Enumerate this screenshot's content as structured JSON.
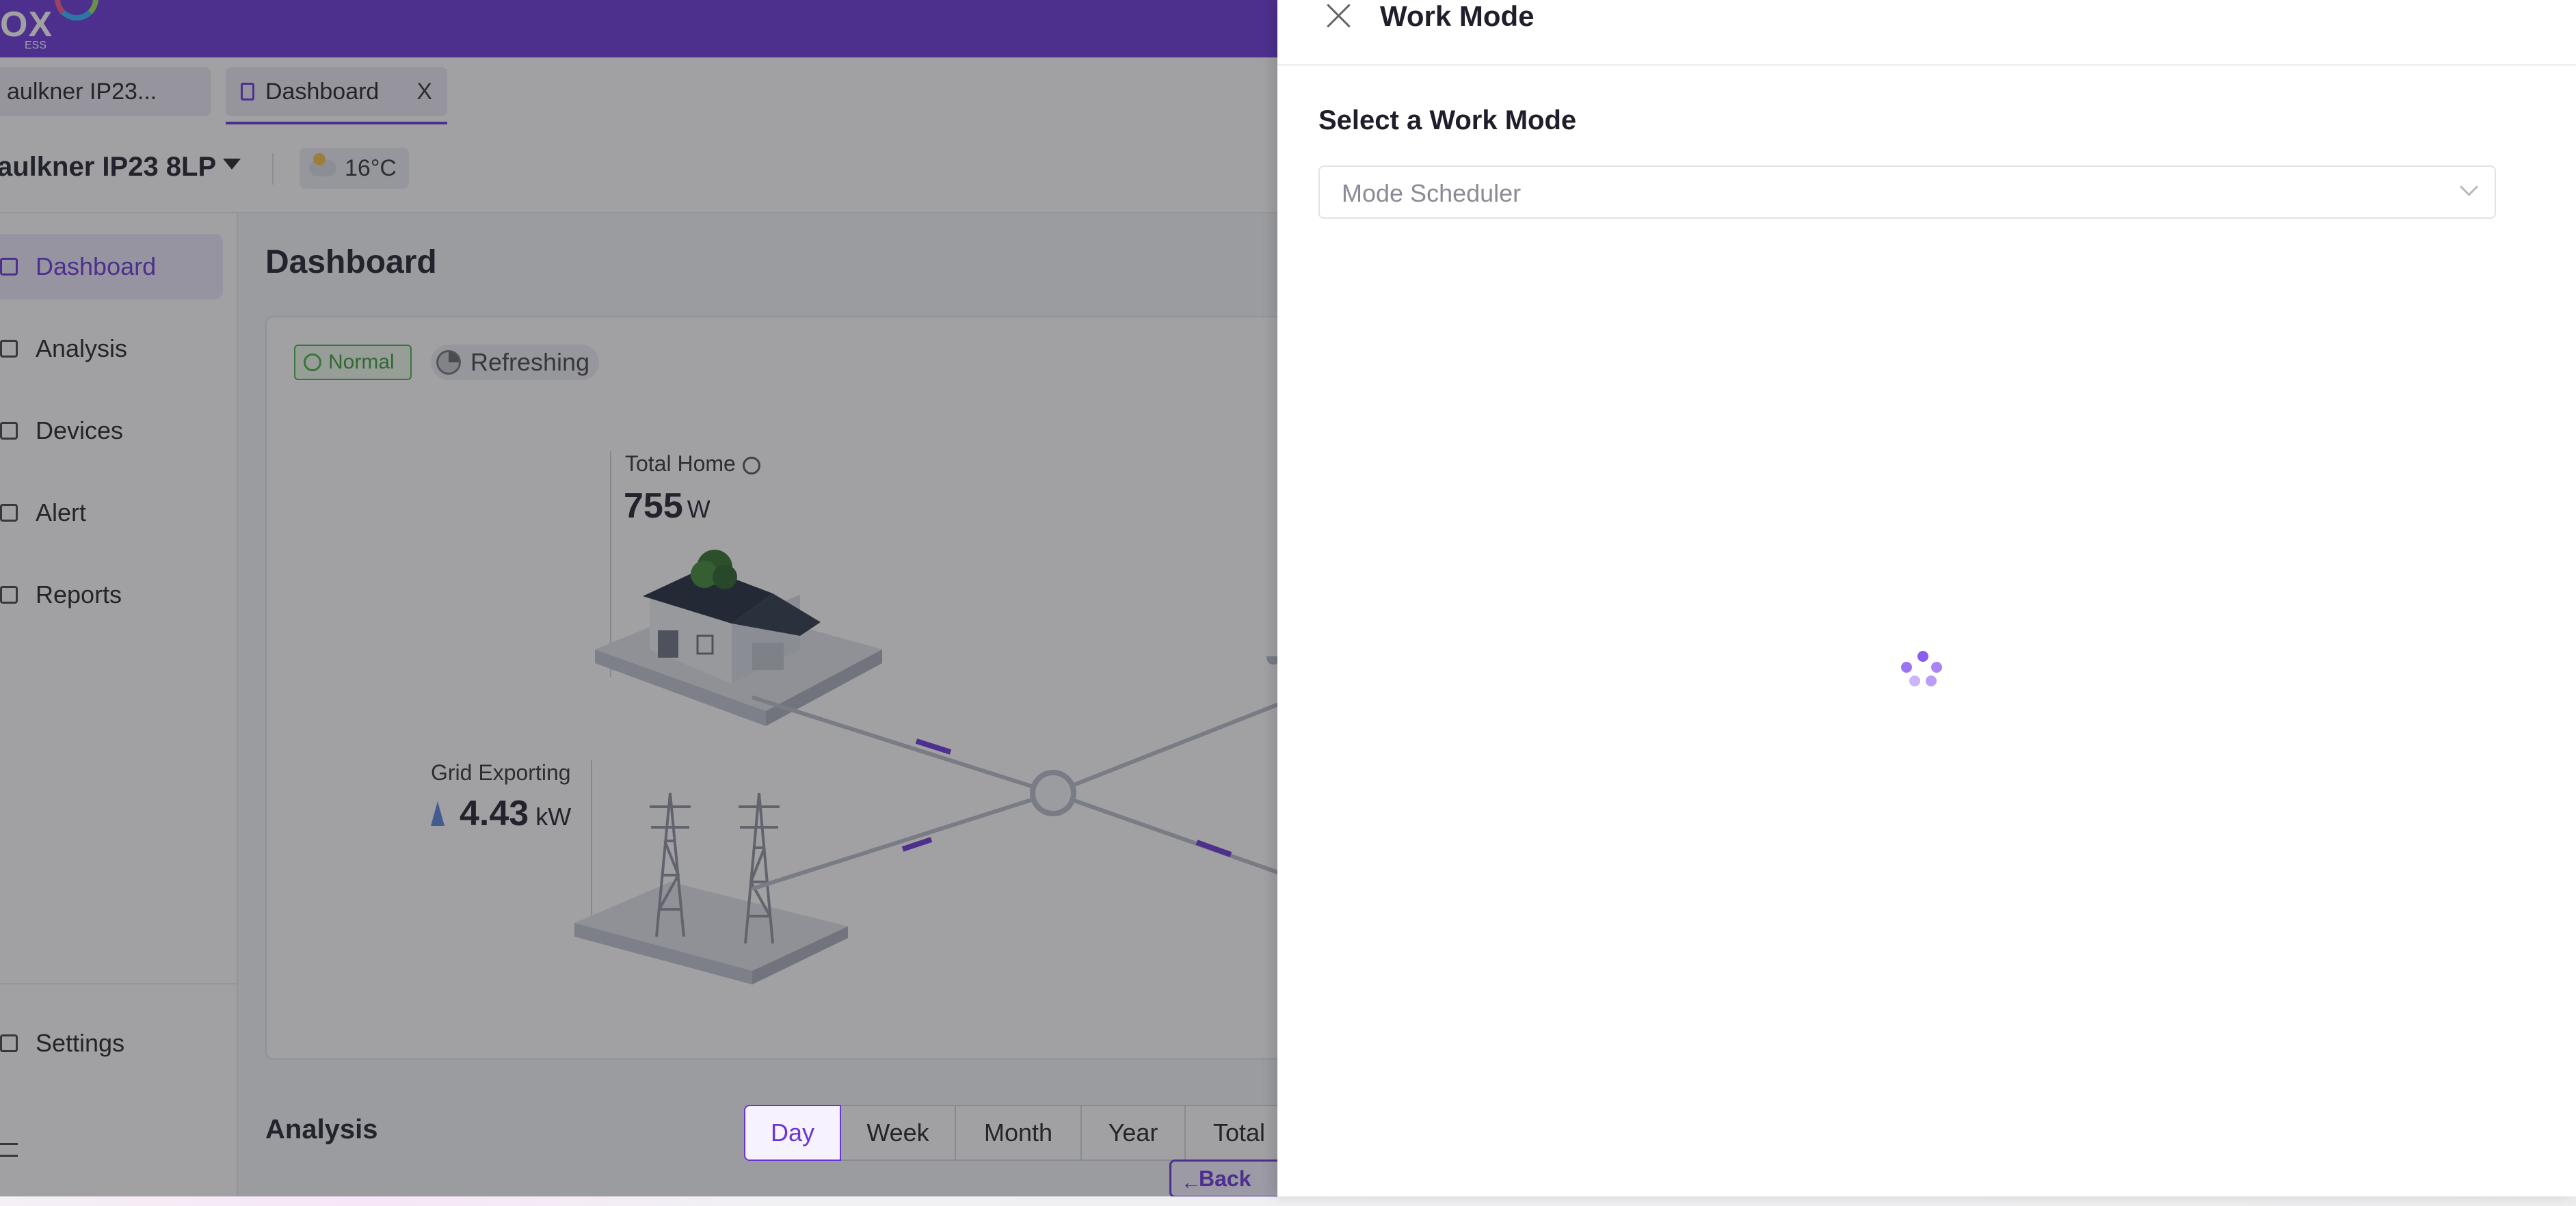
{
  "app": {
    "logo_text": "OX",
    "logo_subtext": "ESS",
    "tabs": [
      {
        "label": "aulkner IP23..."
      },
      {
        "label": "Dashboard",
        "close_label": "X"
      }
    ],
    "plant": {
      "name": "aulkner IP23 8LP",
      "temperature": "16°C"
    },
    "sidebar": {
      "items": [
        {
          "label": "Dashboard",
          "icon": "home-icon",
          "active": true
        },
        {
          "label": "Analysis",
          "icon": "bar-chart-icon"
        },
        {
          "label": "Devices",
          "icon": "device-icon"
        },
        {
          "label": "Alert",
          "icon": "alarm-icon"
        },
        {
          "label": "Reports",
          "icon": "report-icon"
        }
      ],
      "settings_label": "Settings"
    },
    "main": {
      "title": "Dashboard",
      "status_normal": "Normal",
      "status_refreshing": "Refreshing",
      "home": {
        "label": "Total Home",
        "value": "755",
        "unit": "W"
      },
      "grid": {
        "label": "Grid Exporting",
        "value": "4.43",
        "unit": "kW"
      },
      "analysis": {
        "title": "Analysis",
        "periods": [
          "Day",
          "Week",
          "Month",
          "Year",
          "Total"
        ],
        "active_period": "Day",
        "back_label": "Back"
      }
    },
    "colors": {
      "brand": "#6a35d6",
      "status_ok": "#48b04a"
    }
  },
  "drawer": {
    "title": "Work Mode",
    "section_label": "Select a Work Mode",
    "selected_mode": "Mode Scheduler",
    "loading": true
  }
}
